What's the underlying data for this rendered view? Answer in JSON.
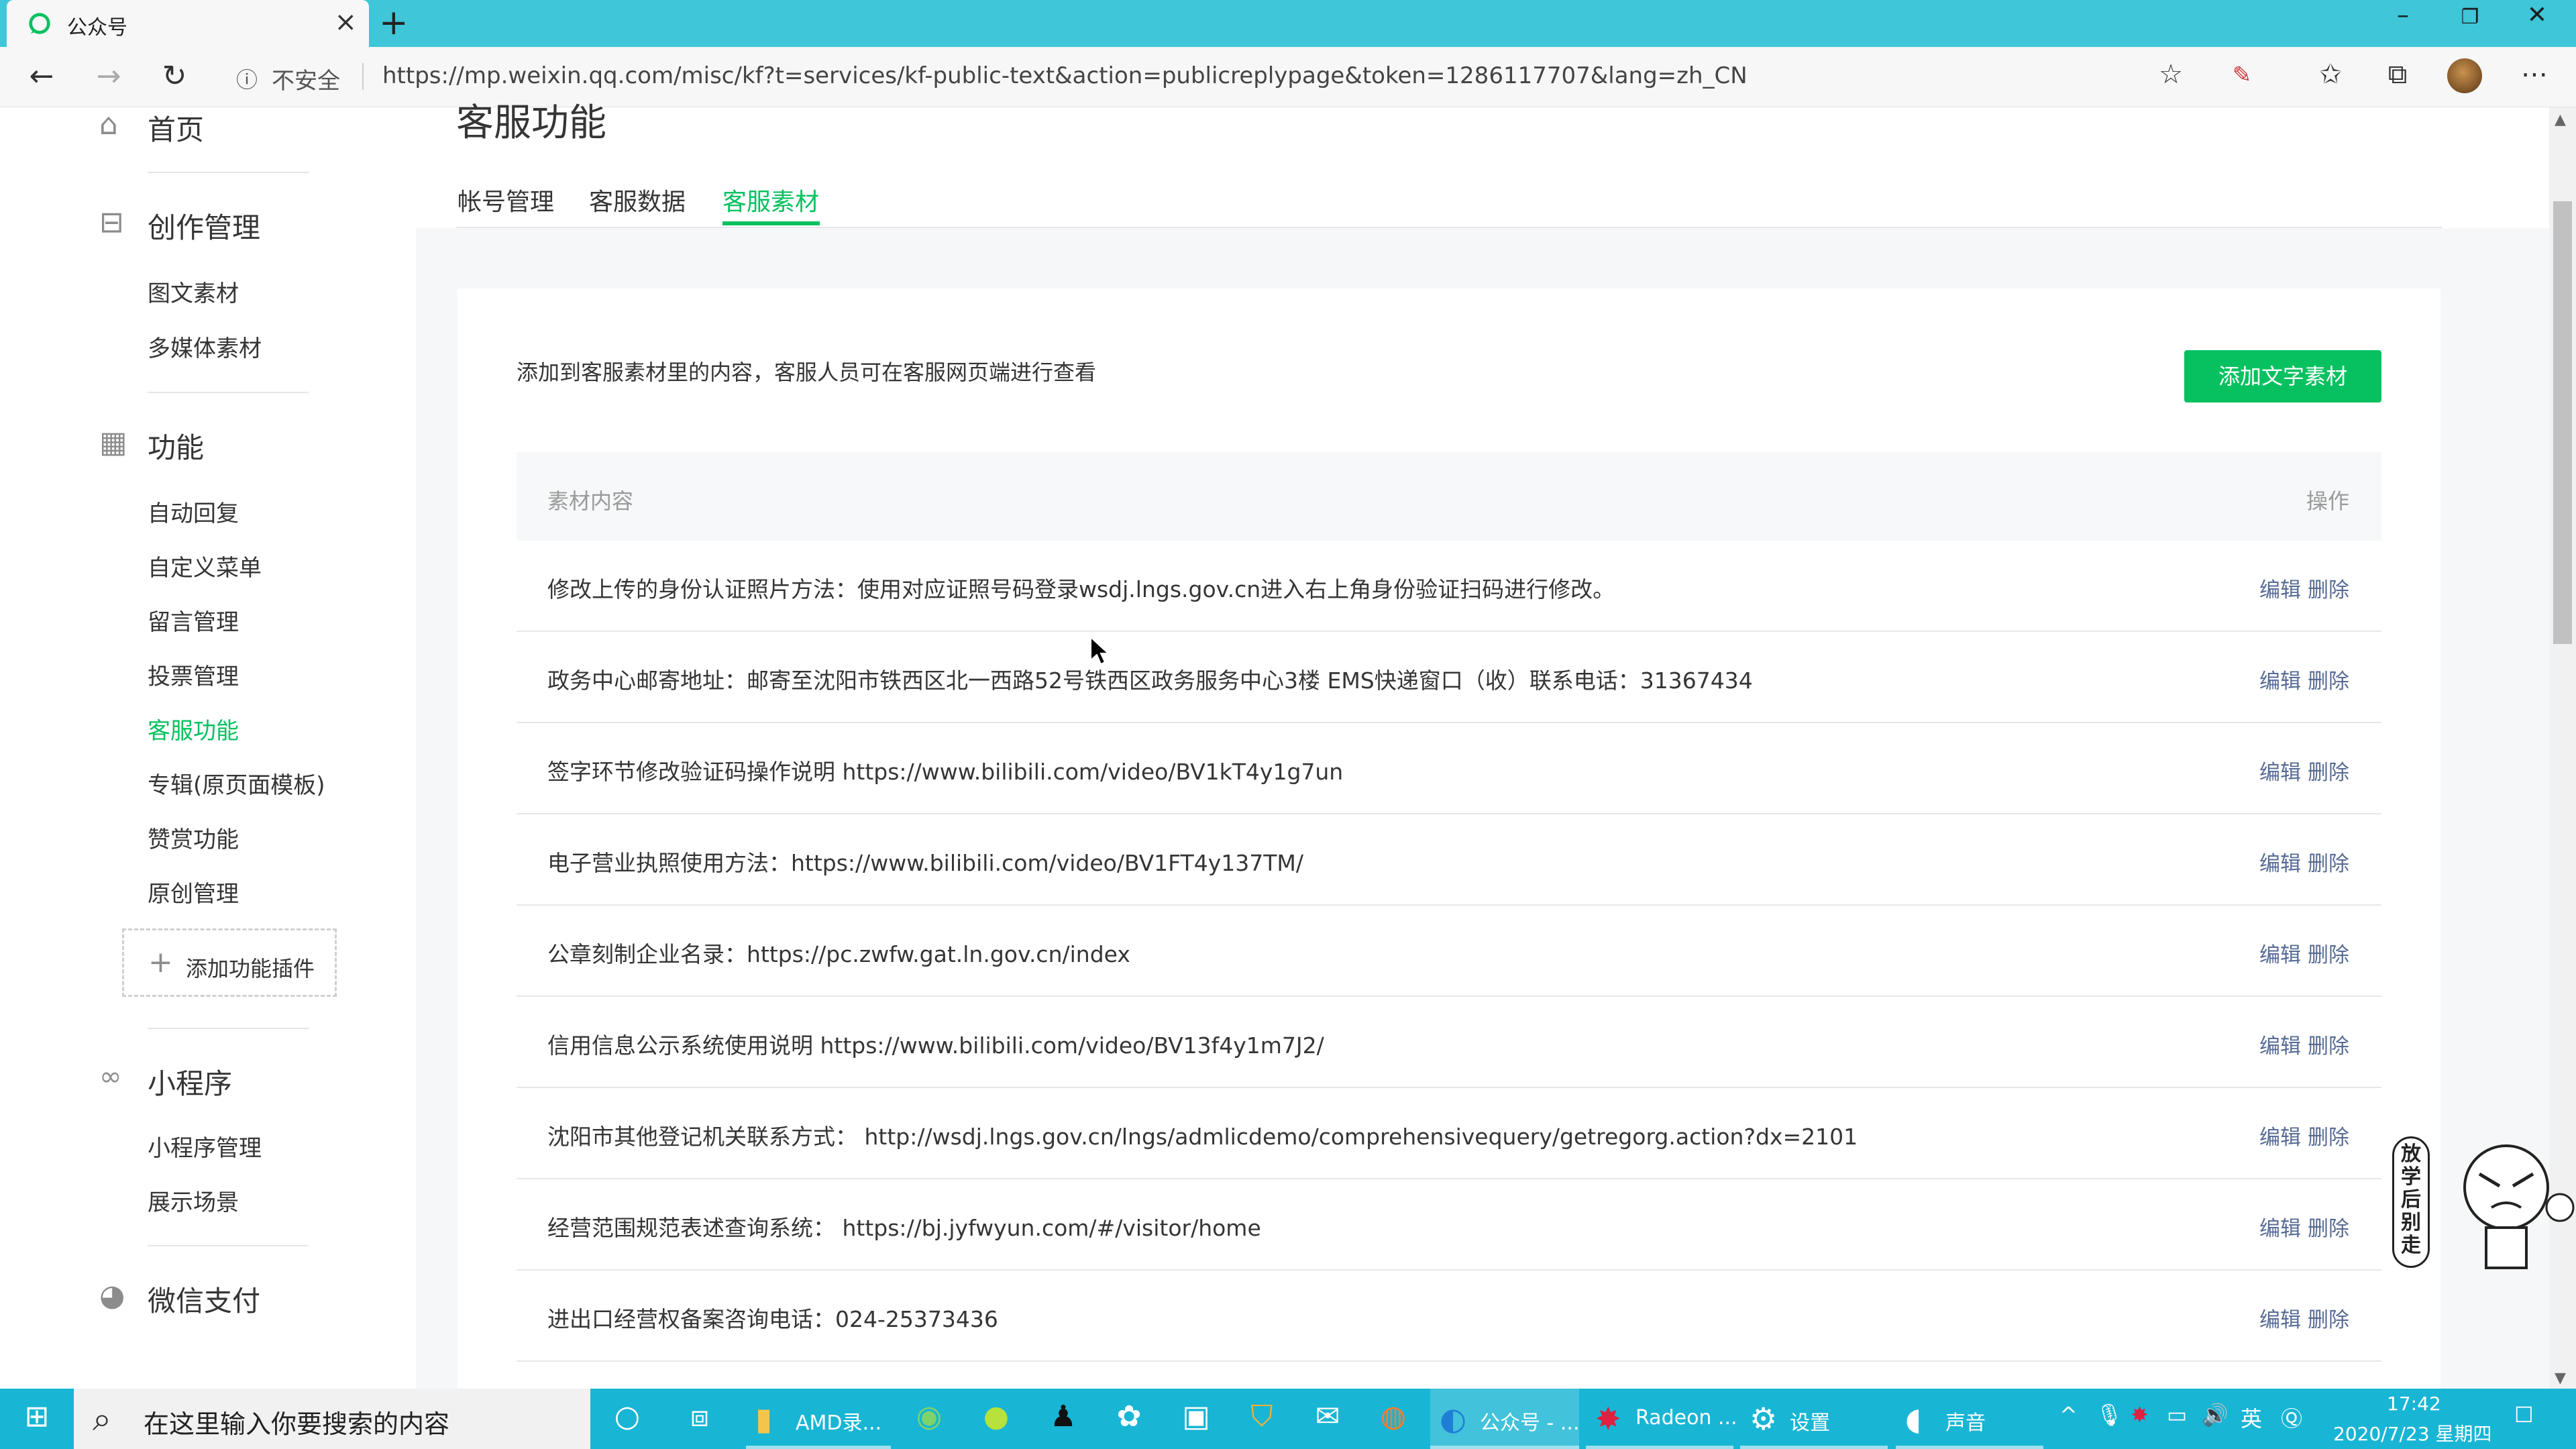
{
  "browser": {
    "tab_title": "公众号",
    "security_label": "不安全",
    "url": "https://mp.weixin.qq.com/misc/kf?t=services/kf-public-text&action=publicreplypage&token=1286117707&lang=zh_CN"
  },
  "sidebar": {
    "home": "首页",
    "creation": {
      "title": "创作管理",
      "items": [
        "图文素材",
        "多媒体素材"
      ]
    },
    "features": {
      "title": "功能",
      "items": [
        "自动回复",
        "自定义菜单",
        "留言管理",
        "投票管理",
        "客服功能",
        "专辑(原页面模板)",
        "赞赏功能",
        "原创管理"
      ],
      "active_item": "客服功能"
    },
    "add_plugin": "添加功能插件",
    "miniprogram": {
      "title": "小程序",
      "items": [
        "小程序管理",
        "展示场景"
      ]
    },
    "pay": "微信支付"
  },
  "main": {
    "title": "客服功能",
    "tabs": [
      "帐号管理",
      "客服数据",
      "客服素材"
    ],
    "active_tab": "客服素材",
    "description": "添加到客服素材里的内容，客服人员可在客服网页端进行查看",
    "add_button": "添加文字素材",
    "table": {
      "col_content": "素材内容",
      "col_ops": "操作",
      "edit_label": "编辑",
      "delete_label": "删除",
      "rows": [
        "修改上传的身份认证照片方法：使用对应证照号码登录wsdj.lngs.gov.cn进入右上角身份验证扫码进行修改。",
        "政务中心邮寄地址：邮寄至沈阳市铁西区北一西路52号铁西区政务服务中心3楼 EMS快递窗口（收）联系电话：31367434",
        "签字环节修改验证码操作说明 https://www.bilibili.com/video/BV1kT4y1g7un",
        "电子营业执照使用方法：https://www.bilibili.com/video/BV1FT4y137TM/",
        "公章刻制企业名录：https://pc.zwfw.gat.ln.gov.cn/index",
        "信用信息公示系统使用说明 https://www.bilibili.com/video/BV13f4y1m7J2/",
        "沈阳市其他登记机关联系方式： http://wsdj.lngs.gov.cn/lngs/admlicdemo/comprehensivequery/getregorg.action?dx=2101",
        "经营范围规范表述查询系统： https://bj.jyfwyun.com/#/visitor/home",
        "进出口经营权备案咨询电话：024-25373436"
      ]
    }
  },
  "sticker": {
    "text": "放学后别走"
  },
  "taskbar": {
    "search_placeholder": "在这里输入你要搜索的内容",
    "apps": [
      {
        "label": "AMD录...",
        "icon": "folder-icon"
      },
      {
        "label": "公众号 - ...",
        "icon": "edge-icon"
      },
      {
        "label": "Radeon ...",
        "icon": "radeon-icon"
      },
      {
        "label": "设置",
        "icon": "gear-icon"
      },
      {
        "label": "声音",
        "icon": "speaker-icon"
      }
    ],
    "ime": "英",
    "time": "17:42",
    "date": "2020/7/23 星期四"
  },
  "colors": {
    "accent": "#07c160",
    "link": "#576b95",
    "taskbar": "#19b5d4",
    "titlebar": "#3fc6d8"
  }
}
